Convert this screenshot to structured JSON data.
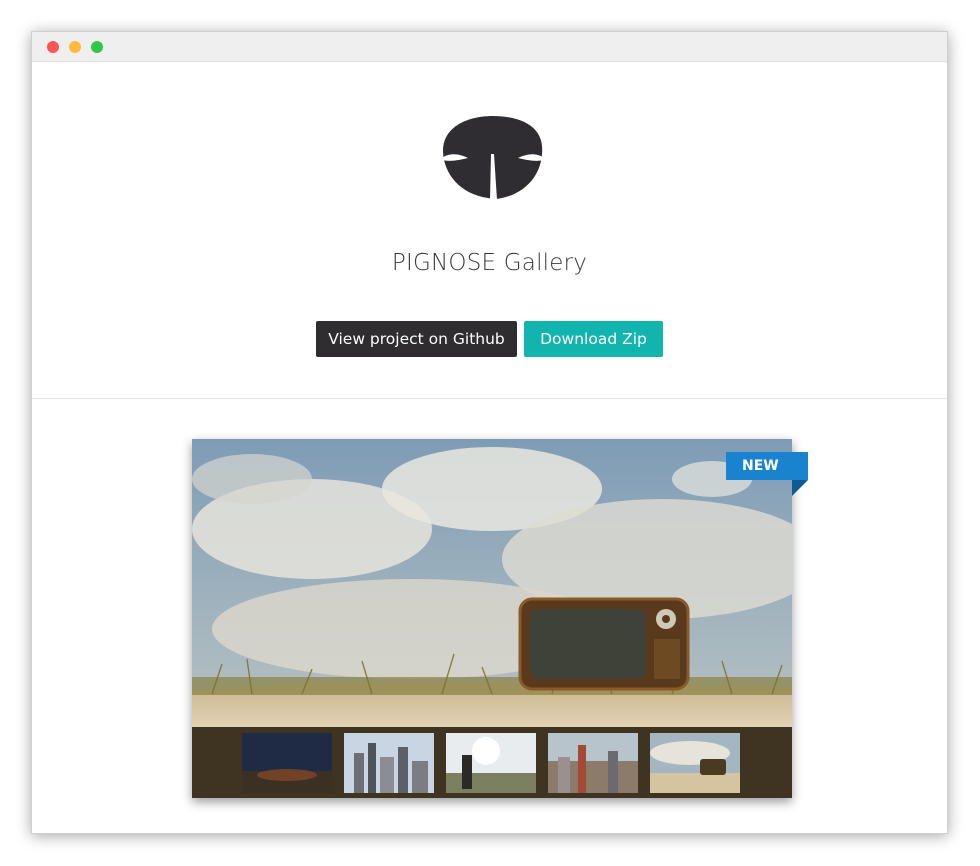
{
  "window": {
    "controls": [
      "close",
      "minimize",
      "maximize"
    ]
  },
  "header": {
    "logo_icon": "pig-nose-logo-icon",
    "title": "PIGNOSE Gallery",
    "buttons": {
      "github_label": "View project on Github",
      "zip_label": "Download Zip"
    }
  },
  "gallery": {
    "badge": "NEW",
    "main_image": "tv-in-dune-grass",
    "thumbnails": [
      {
        "name": "night-sky-mountains"
      },
      {
        "name": "city-skyline"
      },
      {
        "name": "person-in-sunlight-field"
      },
      {
        "name": "city-aerial"
      },
      {
        "name": "tv-in-dune-grass"
      }
    ]
  },
  "colors": {
    "github_button": "#2f2d30",
    "zip_button": "#12b5ad",
    "badge": "#1a83d0",
    "title_text": "#3a3a3a"
  }
}
